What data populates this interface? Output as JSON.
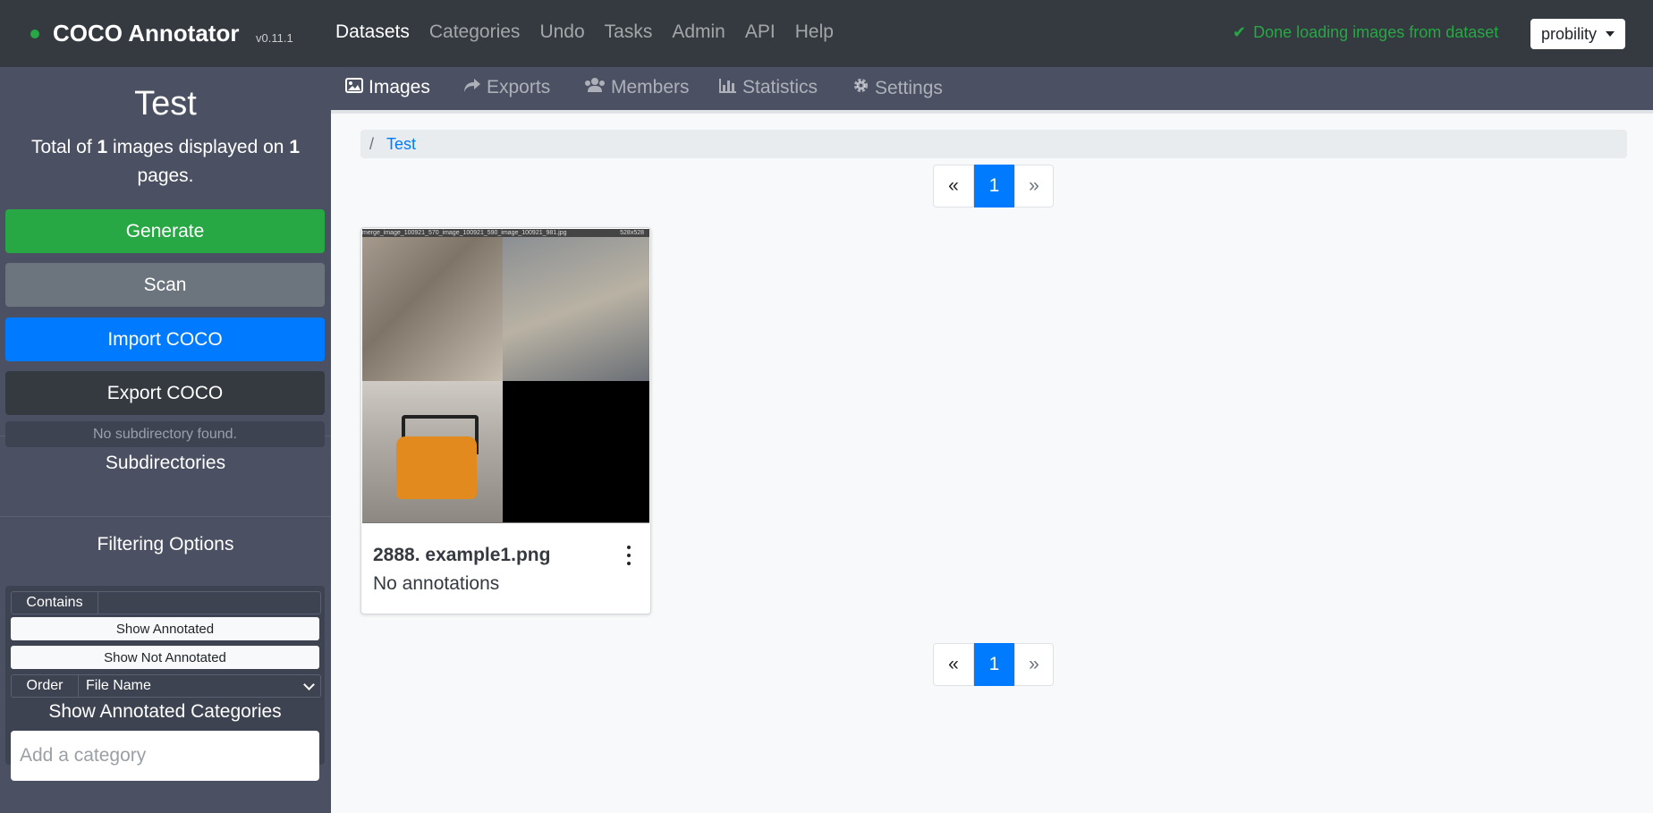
{
  "navbar": {
    "brand": "COCO Annotator",
    "version": "v0.11.1",
    "links": [
      "Datasets",
      "Categories",
      "Undo",
      "Tasks",
      "Admin",
      "API",
      "Help"
    ],
    "active_link": "Datasets",
    "status_text": "Done loading images from dataset",
    "status_icon": "check-icon",
    "user": "probility"
  },
  "sidebar": {
    "dataset_title": "Test",
    "summary_prefix": "Total of ",
    "image_count": "1",
    "summary_middle": " images displayed on ",
    "page_count": "1",
    "summary_suffix": " pages.",
    "buttons": {
      "generate": "Generate",
      "scan": "Scan",
      "import": "Import COCO",
      "export": "Export COCO"
    },
    "subdirectories_title": "Subdirectories",
    "subdirectories_empty": "No subdirectory found.",
    "filtering_title": "Filtering Options",
    "contains_label": "Contains",
    "contains_value": "",
    "show_annotated": "Show Annotated",
    "show_not_annotated": "Show Not Annotated",
    "order_label": "Order",
    "order_value": "File Name",
    "annotated_categories_title": "Show Annotated Categories",
    "category_placeholder": "Add a category"
  },
  "subnav": {
    "tabs": [
      {
        "label": "Images",
        "icon": "image-icon"
      },
      {
        "label": "Exports",
        "icon": "share-icon"
      },
      {
        "label": "Members",
        "icon": "users-icon"
      },
      {
        "label": "Statistics",
        "icon": "bar-chart-icon"
      },
      {
        "label": "Settings",
        "icon": "gear-icon"
      }
    ],
    "active_tab": "Images"
  },
  "main": {
    "breadcrumb": [
      "Test"
    ],
    "pagination": {
      "prev": "«",
      "current": "1",
      "next": "»"
    },
    "images": [
      {
        "thumb_header": "merge_image_100921_570_image_100921_590_image_100921_981.jpg",
        "thumb_size": "528x528",
        "title": "2888. example1.png",
        "annotations": "No annotations"
      }
    ]
  },
  "colors": {
    "navbar_bg": "#343a40",
    "sidebar_bg": "#4b5162",
    "success": "#28a745",
    "primary": "#007bff",
    "secondary": "#6c757d"
  }
}
